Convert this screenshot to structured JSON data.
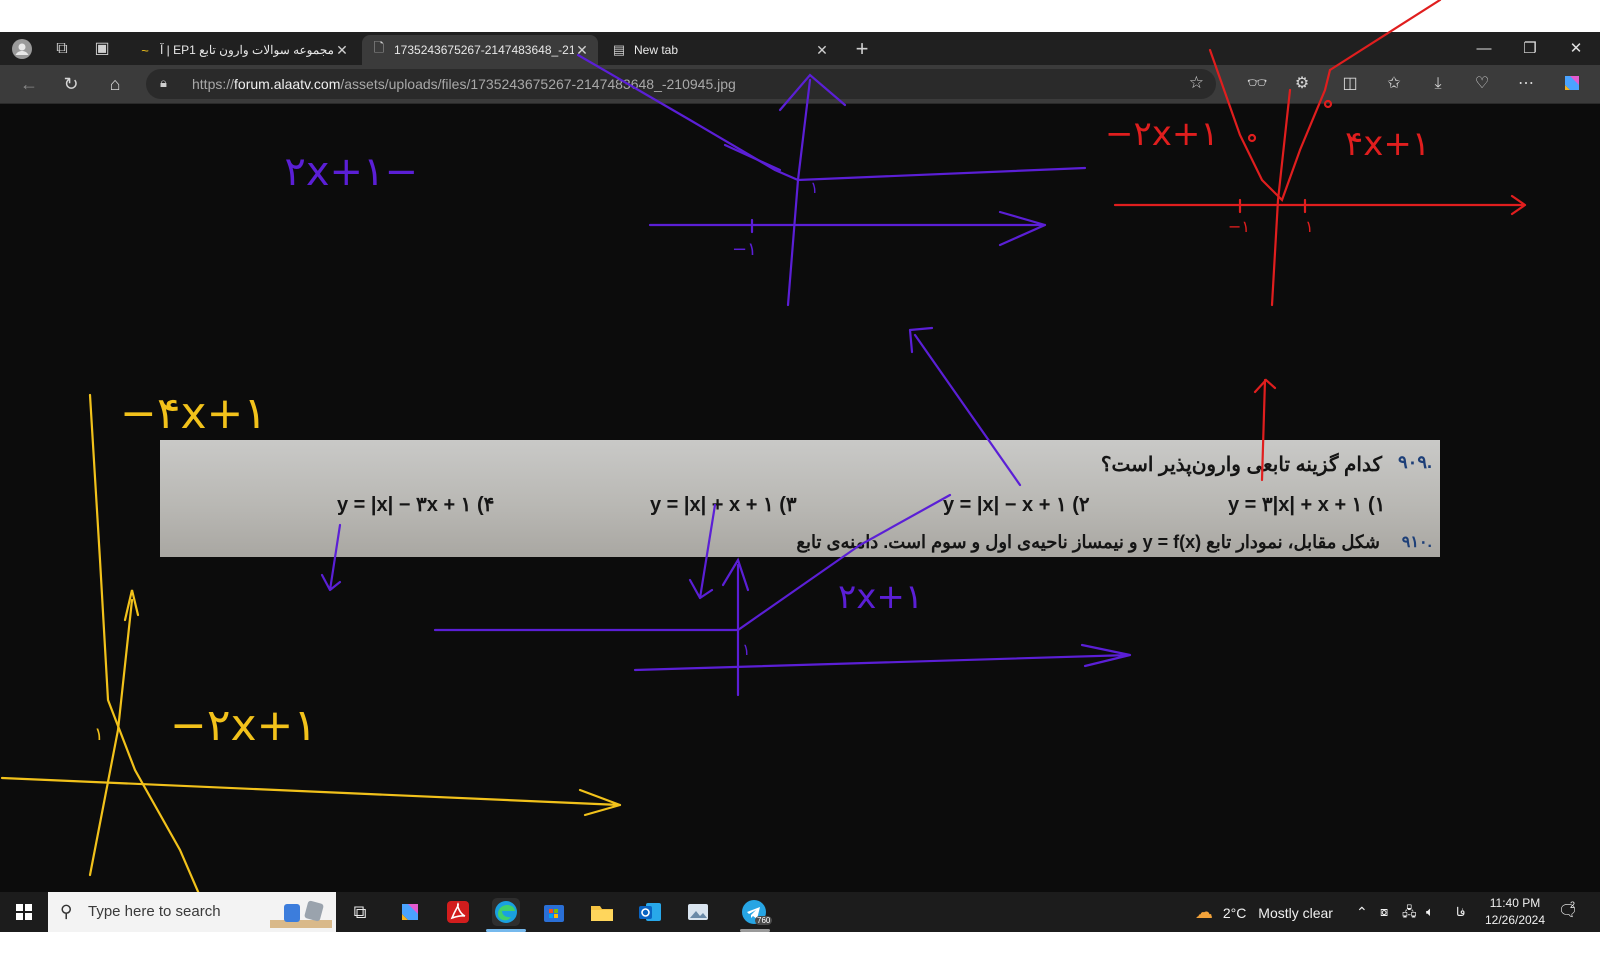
{
  "browser": {
    "tabs": [
      {
        "title": "مجموعه سوالات وارون تابع EP1 | آل...",
        "favicon": "alaa-icon",
        "active": false
      },
      {
        "title": "1735243675267-2147483648_-21...",
        "favicon": "file-icon",
        "active": true
      },
      {
        "title": "New tab",
        "favicon": "newtab-icon",
        "active": false
      }
    ],
    "new_tab_label": "+",
    "window_controls": {
      "minimize": "—",
      "restore": "❐",
      "close": "✕"
    }
  },
  "address_bar": {
    "url_prefix": "https://",
    "url_domain": "forum.alaatv.com",
    "url_path": "/assets/uploads/files/1735243675267-2147483648_-210945.jpg"
  },
  "question": {
    "number": "۹۰۹.",
    "title": "کدام گزینه تابعی وارون‌پذیر است؟",
    "options": [
      {
        "text": "۱) y = ۳|x| + x + ۱"
      },
      {
        "text": "۲) y = |x| − x + ۱"
      },
      {
        "text": "۳) y = |x| + x + ۱"
      },
      {
        "text": "۴) y = |x| − ۳x + ۱"
      }
    ],
    "next_number": "۹۱۰.",
    "next_partial": "شکل مقابل، نمودار تابع y = f(x) و نیمساز ناحیه‌ی اول و سوم است. دامنه‌ی تابع"
  },
  "annotations": {
    "purple_top_left": "−۲x+۱",
    "purple_tick_neg1": "−۱",
    "purple_tick_1": "۱",
    "purple_mid_label": "۲x+۱",
    "purple_mid_tick": "۱",
    "red_left": "−۲x+۱",
    "red_right": "۴x+۱",
    "red_tick_neg1": "−۱",
    "red_tick_1": "۱",
    "yellow_top": "−۴x+۱",
    "yellow_bottom": "−۲x+۱",
    "yellow_tick": "۱",
    "colors": {
      "purple": "#5b1fd6",
      "red": "#e01e1e",
      "yellow": "#f2c21b"
    }
  },
  "taskbar": {
    "search_placeholder": "Type here to search",
    "weather_temp": "2°C",
    "weather_text": "Mostly clear",
    "language": "فا",
    "time": "11:40 PM",
    "date": "12/26/2024",
    "telegram_badge": "760",
    "notification_count": "2",
    "apps": [
      "task-view-icon",
      "copilot-icon",
      "acrobat-icon",
      "edge-icon",
      "store-icon",
      "file-explorer-icon",
      "outlook-icon",
      "photos-icon",
      "telegram-icon"
    ]
  }
}
